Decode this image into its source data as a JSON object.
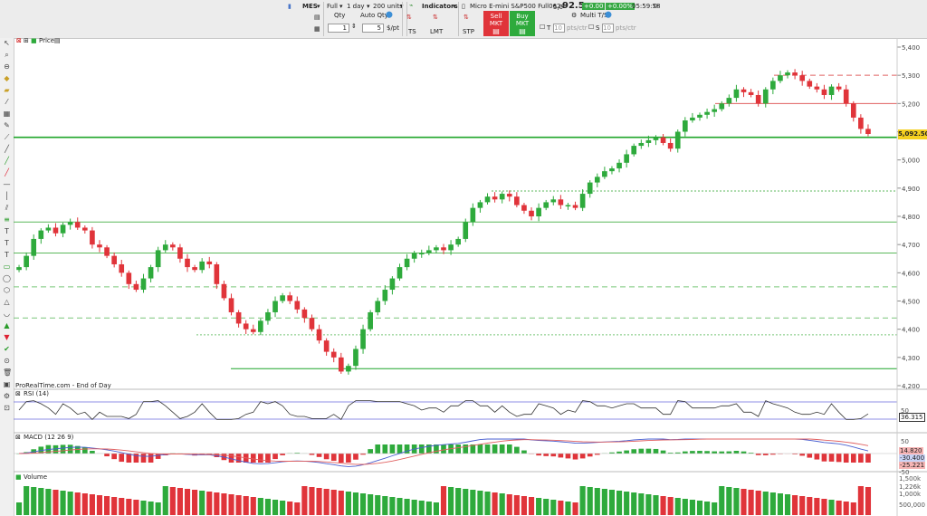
{
  "toolbar": {
    "symbol": "MES",
    "view_mode": "Full",
    "timeframe": "1 day",
    "units": "200 units",
    "indicators_label": "Indicators",
    "instrument_name": "Micro E-mini S&P500 Full0624",
    "price_small": "5,0",
    "price_big": "92.5",
    "change_points": "+0.00",
    "change_percent": "+0.00%",
    "clock": "05:59:58",
    "qty_label": "Qty",
    "auto_qty_label": "Auto Qty",
    "qty_value": "1",
    "per_pt_value": "5",
    "per_pt_unit": "$/pt",
    "order_ts": "TS",
    "order_lmt": "LMT",
    "order_stp": "STP",
    "sell_label": "Sell MKT",
    "buy_label": "Buy MKT",
    "multi_ts_label": "Multi T/S",
    "t_label": "T",
    "s_label": "S",
    "pts_value": "10",
    "pts_unit": "pts/ctr",
    "sell_color": "#e0343a",
    "buy_color": "#2eaa3c"
  },
  "price_panel": {
    "label": "Price",
    "footer_left": "ProRealTime.com - End of Day",
    "current_price_tag": "5,092.50"
  },
  "rsi_panel": {
    "label": "RSI (14)",
    "value_tag": "36.315",
    "tick_upper": "50"
  },
  "macd_panel": {
    "label": "MACD (12 26 9)",
    "tag_1": "14.820",
    "tag_2": "-30.400",
    "tag_3": "-25.221",
    "tick_upper": "50",
    "tick_lower": "-50"
  },
  "volume_panel": {
    "label": "Volume",
    "tick_1": "1,500k",
    "tick_2": "1,226k",
    "tick_3": "1,000k",
    "tick_4": "500,000"
  },
  "chart_data": {
    "type": "candlestick",
    "series_up_color": "#2eaa3c",
    "series_down_color": "#e0343a",
    "ylim": [
      4200,
      5400
    ],
    "y_ticks": [
      "5,400",
      "5,300",
      "5,200",
      "5,100",
      "5,000",
      "4,900",
      "4,800",
      "4,700",
      "4,600",
      "4,500",
      "4,400",
      "4,300",
      "4,200"
    ],
    "y_tick_values": [
      5400,
      5300,
      5200,
      5100,
      5000,
      4900,
      4800,
      4700,
      4600,
      4500,
      4400,
      4300,
      4200
    ],
    "close_path": [
      4620,
      4660,
      4720,
      4750,
      4760,
      4740,
      4770,
      4780,
      4760,
      4750,
      4700,
      4690,
      4660,
      4630,
      4600,
      4560,
      4540,
      4580,
      4620,
      4680,
      4700,
      4690,
      4650,
      4620,
      4610,
      4640,
      4630,
      4560,
      4510,
      4460,
      4420,
      4400,
      4390,
      4430,
      4460,
      4500,
      4520,
      4500,
      4470,
      4440,
      4400,
      4360,
      4320,
      4300,
      4250,
      4270,
      4330,
      4400,
      4460,
      4500,
      4540,
      4580,
      4620,
      4650,
      4670,
      4670,
      4680,
      4690,
      4680,
      4700,
      4720,
      4780,
      4830,
      4850,
      4870,
      4860,
      4880,
      4870,
      4840,
      4820,
      4800,
      4830,
      4850,
      4860,
      4840,
      4840,
      4830,
      4880,
      4920,
      4940,
      4960,
      4970,
      4990,
      5020,
      5050,
      5060,
      5070,
      5080,
      5060,
      5040,
      5100,
      5140,
      5150,
      5160,
      5170,
      5180,
      5200,
      5220,
      5250,
      5240,
      5230,
      5200,
      5250,
      5280,
      5300,
      5310,
      5300,
      5280,
      5260,
      5250,
      5230,
      5260,
      5250,
      5200,
      5150,
      5110,
      5092
    ],
    "horizontal_levels": [
      {
        "value": 5300,
        "style": "dashed",
        "color": "#e06060"
      },
      {
        "value": 5200,
        "style": "solid",
        "color": "#e06060"
      },
      {
        "value": 5080,
        "style": "solid-thick",
        "color": "#1fa52a"
      },
      {
        "value": 4890,
        "style": "dotted",
        "color": "#5cb85c"
      },
      {
        "value": 4780,
        "style": "solid",
        "color": "#5cb85c"
      },
      {
        "value": 4670,
        "style": "solid",
        "color": "#5cb85c"
      },
      {
        "value": 4550,
        "style": "dashed",
        "color": "#7ac67a"
      },
      {
        "value": 4440,
        "style": "dashed",
        "color": "#7ac67a"
      },
      {
        "value": 4380,
        "style": "dotted",
        "color": "#7ac67a"
      },
      {
        "value": 4260,
        "style": "solid",
        "color": "#1fa52a"
      }
    ]
  }
}
